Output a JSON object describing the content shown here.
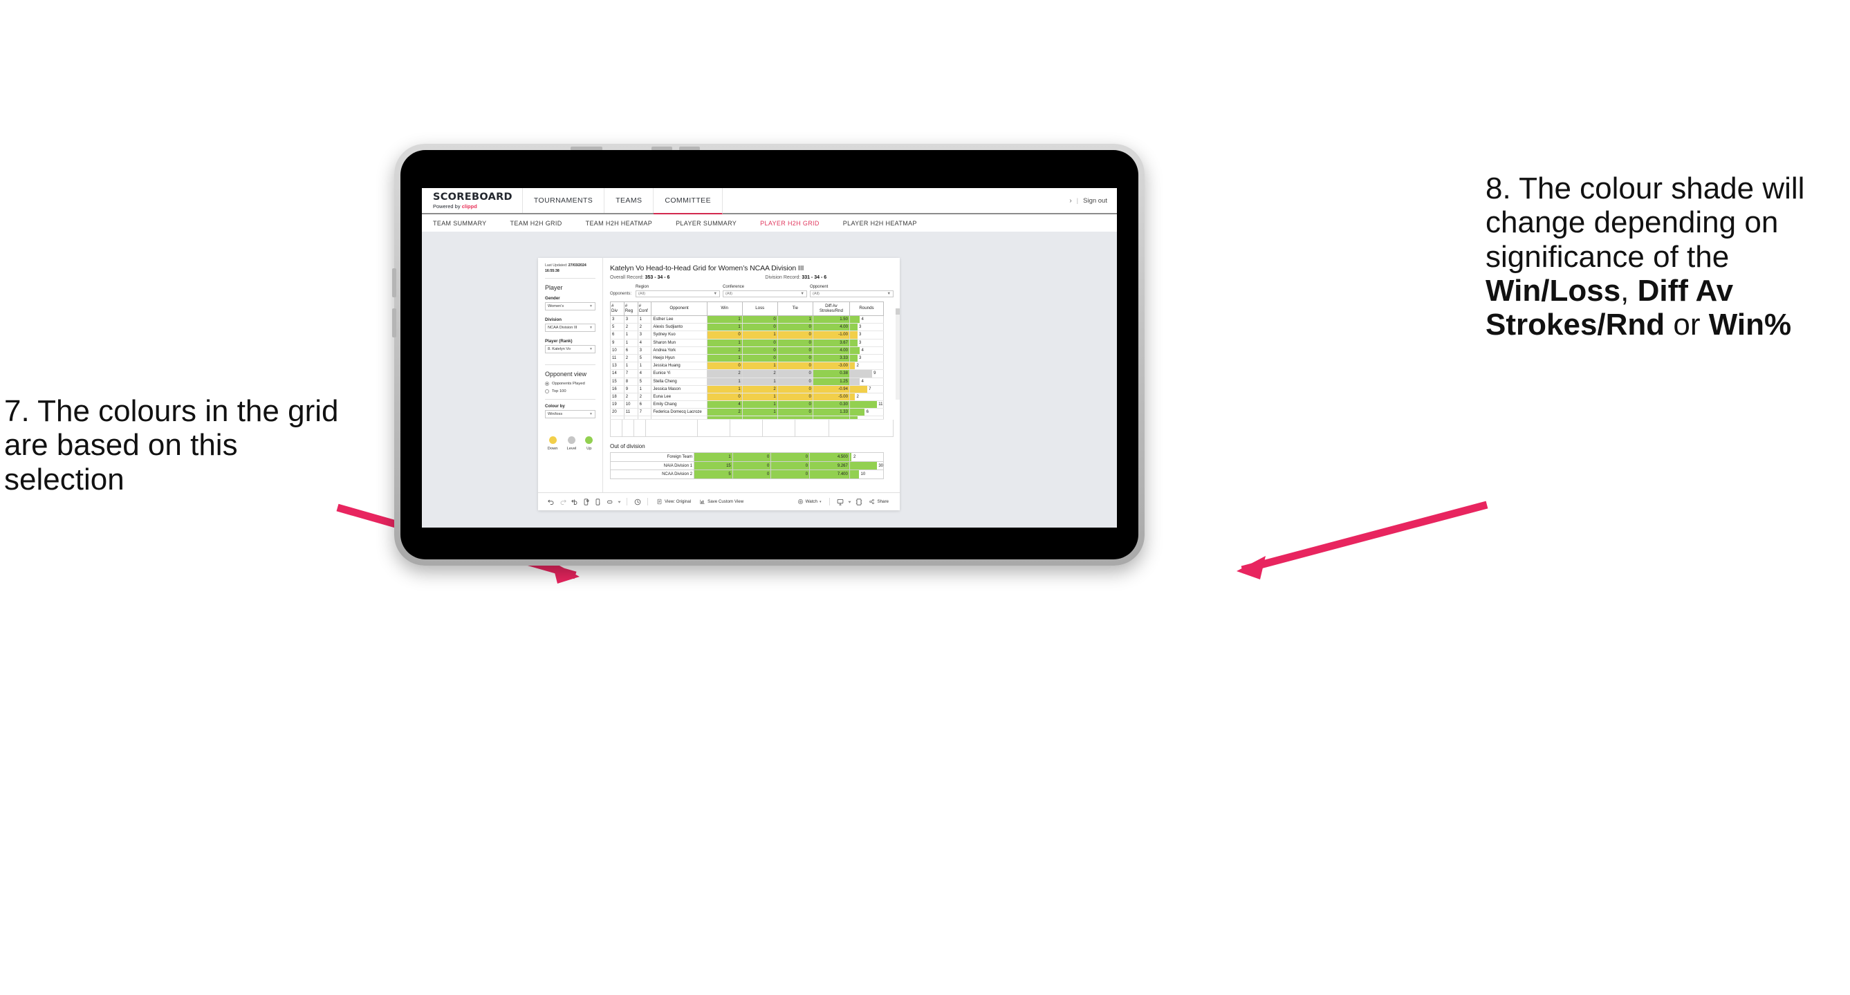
{
  "annotations": {
    "left": {
      "name": "callout-7",
      "text": "7. The colours in the grid are based on this selection"
    },
    "right": {
      "name": "callout-8",
      "prefix": "8. The colour shade will change depending on significance of the ",
      "bold1": "Win/Loss",
      "mid1": ", ",
      "bold2": "Diff Av Strokes/Rnd",
      "mid2": " or ",
      "bold3": "Win%"
    },
    "arrow_color": "#e8255f"
  },
  "appbar": {
    "logo_main": "SCOREBOARD",
    "logo_sub_prefix": "Powered by ",
    "logo_brand": "clippd",
    "nav": [
      {
        "label": "TOURNAMENTS",
        "active": false
      },
      {
        "label": "TEAMS",
        "active": false
      },
      {
        "label": "COMMITTEE",
        "active": true
      }
    ],
    "chevron": "›",
    "separator": "|",
    "sign_out": "Sign out"
  },
  "subnav": {
    "items": [
      {
        "label": "TEAM SUMMARY",
        "active": false
      },
      {
        "label": "TEAM H2H GRID",
        "active": false
      },
      {
        "label": "TEAM H2H HEATMAP",
        "active": false
      },
      {
        "label": "PLAYER SUMMARY",
        "active": false
      },
      {
        "label": "PLAYER H2H GRID",
        "active": true
      },
      {
        "label": "PLAYER H2H HEATMAP",
        "active": false
      }
    ]
  },
  "panel": {
    "last_updated_label": "Last Updated: ",
    "last_updated_value": "27/03/2024 16:55:38",
    "heading": "Player",
    "fields": [
      {
        "label": "Gender",
        "value": "Women’s"
      },
      {
        "label": "Division",
        "value": "NCAA Division III"
      },
      {
        "label": "Player (Rank)",
        "value": "8. Katelyn Vo"
      }
    ],
    "opponent_view": {
      "heading": "Opponent view",
      "options": [
        {
          "label": "Opponents Played",
          "selected": true
        },
        {
          "label": "Top 100",
          "selected": false
        }
      ]
    },
    "colour_by": {
      "label": "Colour by",
      "value": "Win/loss"
    },
    "legend": [
      {
        "label": "Down",
        "color": "#f2cf4a"
      },
      {
        "label": "Level",
        "color": "#c6c6c6"
      },
      {
        "label": "Up",
        "color": "#92d050"
      }
    ]
  },
  "main": {
    "title": "Katelyn Vo Head-to-Head Grid for Women’s NCAA Division III",
    "overall_label": "Overall Record: ",
    "overall_value": "353 -  34 - 6",
    "division_label": "Division Record: ",
    "division_value": "331 -  34 - 6",
    "opponents_label": "Opponents:",
    "filters": [
      {
        "label": "Region",
        "value": "(All)"
      },
      {
        "label": "Conference",
        "value": "(All)"
      },
      {
        "label": "Opponent",
        "value": "(All)"
      }
    ]
  },
  "chart_data": {
    "type": "table",
    "title": "Katelyn Vo Head-to-Head Grid for Women’s NCAA Division III",
    "columns": [
      "# Div",
      "# Reg",
      "# Conf",
      "Opponent",
      "Win",
      "Loss",
      "Tie",
      "Diff Av Strokes/Rnd",
      "Rounds"
    ],
    "column_headers_two_line": [
      [
        "#",
        "Div"
      ],
      [
        "#",
        "Reg"
      ],
      [
        "#",
        "Conf"
      ],
      [
        "Opponent",
        ""
      ],
      [
        "Win",
        ""
      ],
      [
        "Loss",
        ""
      ],
      [
        "Tie",
        ""
      ],
      [
        "Diff Av",
        "Strokes/Rnd"
      ],
      [
        "Rounds",
        ""
      ]
    ],
    "rounds_max": 30,
    "rows": [
      {
        "div": "3",
        "reg": "3",
        "conf": "1",
        "opponent": "Esther Lee",
        "win": "1",
        "loss": "0",
        "tie": "1",
        "diff": "1.50",
        "rounds": "4",
        "color": "g"
      },
      {
        "div": "5",
        "reg": "2",
        "conf": "2",
        "opponent": "Alexis Sudjianto",
        "win": "1",
        "loss": "0",
        "tie": "0",
        "diff": "4.00",
        "rounds": "3",
        "color": "g"
      },
      {
        "div": "6",
        "reg": "1",
        "conf": "3",
        "opponent": "Sydney Kuo",
        "win": "0",
        "loss": "1",
        "tie": "0",
        "diff": "-1.00",
        "rounds": "3",
        "color": "y"
      },
      {
        "div": "9",
        "reg": "1",
        "conf": "4",
        "opponent": "Sharon Mun",
        "win": "1",
        "loss": "0",
        "tie": "0",
        "diff": "3.67",
        "rounds": "3",
        "color": "g"
      },
      {
        "div": "10",
        "reg": "6",
        "conf": "3",
        "opponent": "Andrea York",
        "win": "2",
        "loss": "0",
        "tie": "0",
        "diff": "4.00",
        "rounds": "4",
        "color": "g"
      },
      {
        "div": "11",
        "reg": "2",
        "conf": "5",
        "opponent": "Heejo Hyun",
        "win": "1",
        "loss": "0",
        "tie": "0",
        "diff": "3.33",
        "rounds": "3",
        "color": "g"
      },
      {
        "div": "13",
        "reg": "1",
        "conf": "1",
        "opponent": "Jessica Huang",
        "win": "0",
        "loss": "1",
        "tie": "0",
        "diff": "-3.00",
        "rounds": "2",
        "color": "y"
      },
      {
        "div": "14",
        "reg": "7",
        "conf": "4",
        "opponent": "Eunice Yi",
        "win": "2",
        "loss": "2",
        "tie": "0",
        "diff": "0.38",
        "rounds": "9",
        "color": "gr",
        "diff_color": "g"
      },
      {
        "div": "15",
        "reg": "8",
        "conf": "5",
        "opponent": "Stella Cheng",
        "win": "1",
        "loss": "1",
        "tie": "0",
        "diff": "1.25",
        "rounds": "4",
        "color": "gr",
        "diff_color": "g"
      },
      {
        "div": "16",
        "reg": "9",
        "conf": "1",
        "opponent": "Jessica Mason",
        "win": "1",
        "loss": "2",
        "tie": "0",
        "diff": "-0.94",
        "rounds": "7",
        "color": "y"
      },
      {
        "div": "18",
        "reg": "2",
        "conf": "2",
        "opponent": "Euna Lee",
        "win": "0",
        "loss": "1",
        "tie": "0",
        "diff": "-5.00",
        "rounds": "2",
        "color": "y"
      },
      {
        "div": "19",
        "reg": "10",
        "conf": "6",
        "opponent": "Emily Chang",
        "win": "4",
        "loss": "1",
        "tie": "0",
        "diff": "0.30",
        "rounds": "11",
        "color": "g"
      },
      {
        "div": "20",
        "reg": "11",
        "conf": "7",
        "opponent": "Federica Domecq Lacroze",
        "win": "2",
        "loss": "1",
        "tie": "0",
        "diff": "1.33",
        "rounds": "6",
        "color": "g"
      }
    ]
  },
  "out_of_division": {
    "title": "Out of division",
    "rows": [
      {
        "name": "Foreign Team",
        "win": "1",
        "loss": "0",
        "tie": "0",
        "diff": "4.500",
        "rounds": "2",
        "color": "g"
      },
      {
        "name": "NAIA Division 1",
        "win": "15",
        "loss": "0",
        "tie": "0",
        "diff": "9.267",
        "rounds": "30",
        "color": "g"
      },
      {
        "name": "NCAA Division 2",
        "win": "5",
        "loss": "0",
        "tie": "0",
        "diff": "7.400",
        "rounds": "10",
        "color": "g"
      }
    ]
  },
  "toolbar": {
    "icons": [
      {
        "name": "undo-icon",
        "glyph": "↶"
      },
      {
        "name": "redo-icon",
        "glyph": "↷"
      },
      {
        "name": "revert-icon",
        "glyph": "↺"
      },
      {
        "name": "refresh-data-icon",
        "glyph": "⭮"
      },
      {
        "name": "pause-refresh-icon",
        "glyph": "⏸"
      },
      {
        "name": "highlight-icon",
        "glyph": "▭"
      },
      {
        "name": "highlight-caret-icon",
        "glyph": "▾"
      },
      {
        "name": "history-icon",
        "glyph": "⧖"
      }
    ],
    "view_original": "View: Original",
    "save_custom_view": "Save Custom View",
    "watch": "Watch",
    "watch_caret": "▾",
    "download_caret": "▾",
    "share": "Share"
  }
}
